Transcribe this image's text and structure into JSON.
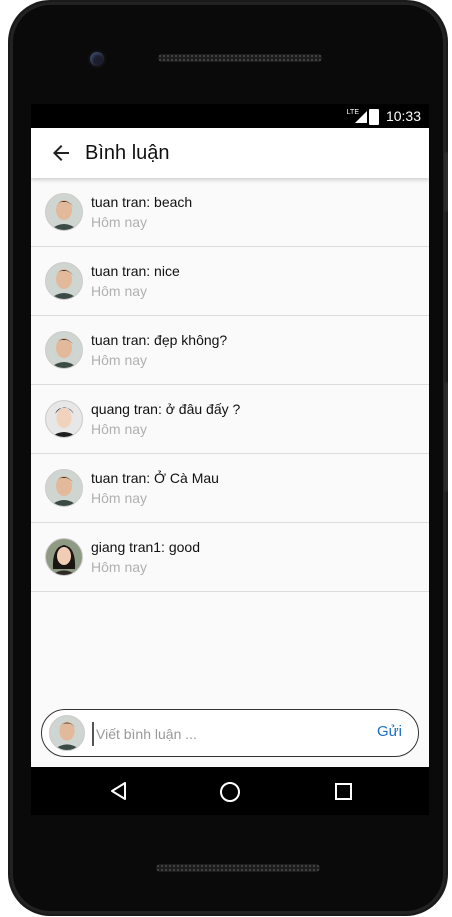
{
  "status_bar": {
    "network": "LTE",
    "time": "10:33"
  },
  "app_bar": {
    "title": "Bình luận",
    "back_icon": "arrow-back-icon"
  },
  "comments": [
    {
      "user": "tuan tran",
      "text": "tuan tran: beach",
      "time": "Hôm nay",
      "avatar": "male-avatar"
    },
    {
      "user": "tuan tran",
      "text": "tuan tran: nice",
      "time": "Hôm nay",
      "avatar": "male-avatar"
    },
    {
      "user": "tuan tran",
      "text": "tuan tran: đẹp không?",
      "time": "Hôm nay",
      "avatar": "male-avatar"
    },
    {
      "user": "quang tran",
      "text": "quang tran: ở đâu đấy ?",
      "time": "Hôm nay",
      "avatar": "male-avatar-2"
    },
    {
      "user": "tuan tran",
      "text": "tuan tran: Ở Cà Mau",
      "time": "Hôm nay",
      "avatar": "male-avatar"
    },
    {
      "user": "giang tran1",
      "text": "giang tran1: good",
      "time": "Hôm nay",
      "avatar": "female-avatar"
    }
  ],
  "comment_input": {
    "placeholder": "Viết bình luận ...",
    "value": "",
    "send_label": "Gửi"
  },
  "nav_bar": {
    "back_icon": "nav-back-icon",
    "home_icon": "nav-home-icon",
    "recents_icon": "nav-recents-icon"
  },
  "colors": {
    "accent": "#1a6fc4",
    "divider": "#dcdcdc",
    "secondary_text": "#b0b0b0"
  }
}
